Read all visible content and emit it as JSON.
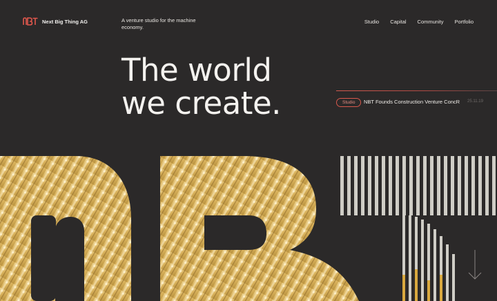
{
  "header": {
    "brand": "Next Big Thing AG",
    "logo_text": "NBT",
    "tagline": "A venture studio for the machine economy.",
    "nav": [
      "Studio",
      "Capital",
      "Community",
      "Portfolio"
    ]
  },
  "hero": {
    "title_line1": "The world",
    "title_line2": "we create."
  },
  "news": {
    "badge": "Studio",
    "headline": "NBT Founds Construction Venture ConcR",
    "date": "25.11.19"
  },
  "colors": {
    "background": "#2b2929",
    "accent": "#d8584c",
    "gold": "#d9b25c"
  },
  "icons": [
    "nbt-logo-icon",
    "arrow-down-icon"
  ]
}
